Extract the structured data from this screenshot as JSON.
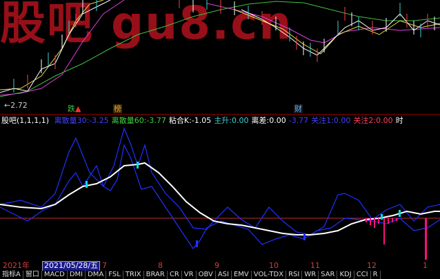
{
  "watermark": "股吧 gu8.cn",
  "colors": {
    "bg": "#000000",
    "price_line": "#ffffff",
    "ma_yellow": "#e8e04a",
    "ma_magenta": "#e040e0",
    "ma_green": "#40c040",
    "ma_white": "#ffffff",
    "blue_line": "#2030ff",
    "red_hline": "#c03030",
    "cyan": "#00e0e0",
    "magenta_bar": "#ff1080"
  },
  "main_chart": {
    "min_price_label": "2.72",
    "markers": [
      {
        "text": "跌",
        "color": "#40c040"
      },
      {
        "text": "榜",
        "color": "#e0a040"
      },
      {
        "text": "财",
        "color": "#60b0ff"
      }
    ]
  },
  "indicator": {
    "name": "股吧(1,1,1,1)",
    "values": [
      {
        "label": "离散量30:",
        "value": "-3.25",
        "color": "#4040ff"
      },
      {
        "label": "离散量60:",
        "value": "-3.77",
        "color": "#40d040"
      },
      {
        "label": "粘合K:",
        "value": "-1.05",
        "color": "#ffffff"
      },
      {
        "label": "主升:",
        "value": "0.00",
        "color": "#40d0d0"
      },
      {
        "label": "离差:",
        "value": "0.00",
        "color": "#ffffff"
      },
      {
        "label": "",
        "value": "-3.77",
        "color": "#4040ff"
      },
      {
        "label": "关注1:",
        "value": "0.00",
        "color": "#4040ff"
      },
      {
        "label": "关注2:",
        "value": "0.00",
        "color": "#ff4060"
      },
      {
        "label": "时",
        "value": "",
        "color": "#ffffff"
      }
    ]
  },
  "x_axis": {
    "year": "2021年",
    "cursor_date": "2021/05/28/五",
    "months": [
      "7",
      "8",
      "9",
      "10",
      "11",
      "12",
      "1"
    ]
  },
  "tabs": [
    "指标A",
    "窗口",
    "MACD",
    "DMI",
    "DMA",
    "FSL",
    "TRIX",
    "BRAR",
    "CR",
    "VR",
    "OBV",
    "ASI",
    "EMV",
    "VOL-TDX",
    "RSI",
    "WR",
    "SAR",
    "KDJ",
    "CCI",
    "R"
  ]
}
